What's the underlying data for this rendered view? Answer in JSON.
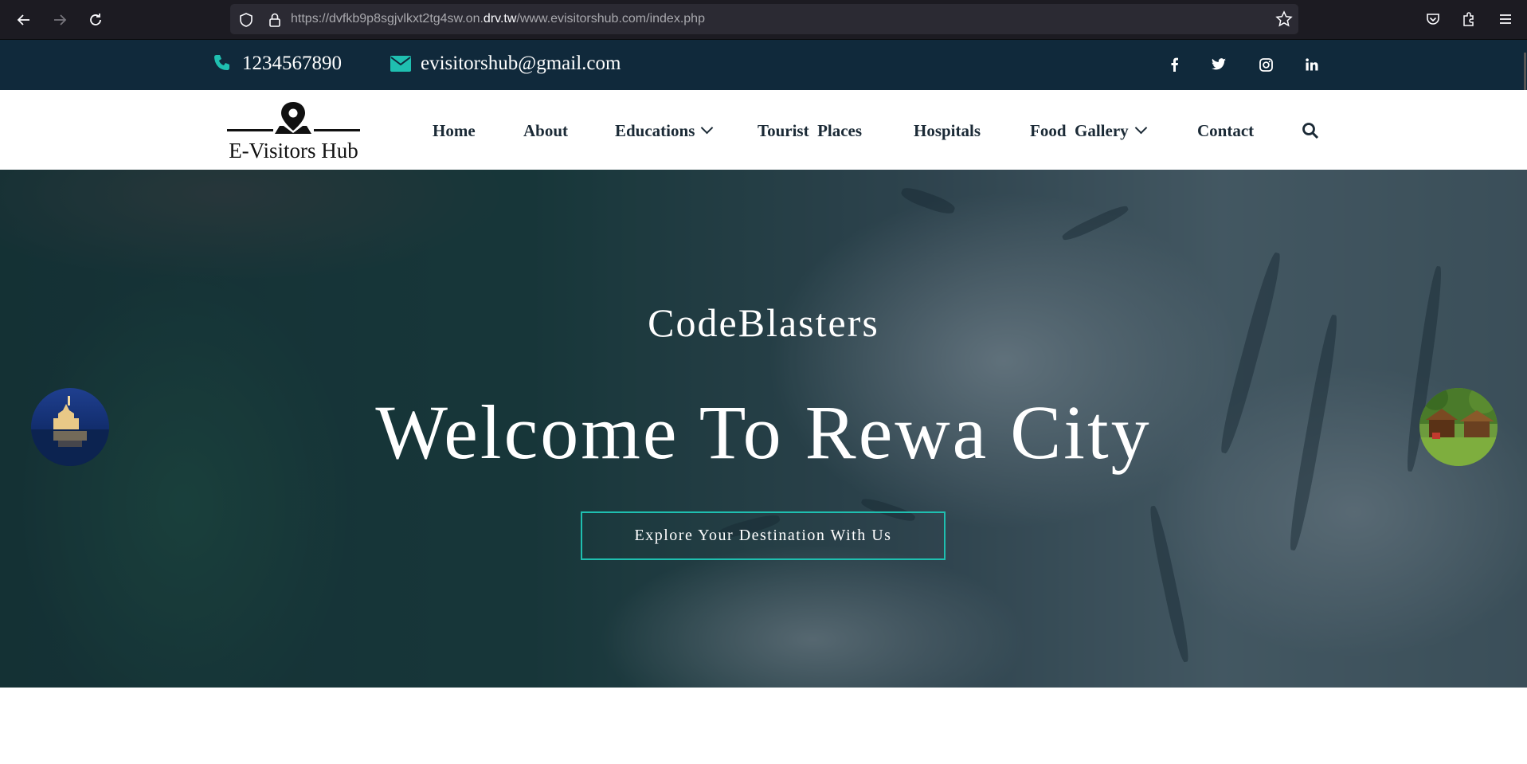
{
  "browser": {
    "url_prefix": "https://dvfkb9p8sgjvlkxt2tg4sw.on.",
    "url_domain": "drv.tw",
    "url_suffix": "/www.evisitorshub.com/index.php"
  },
  "topbar": {
    "phone": "1234567890",
    "email": "evisitorshub@gmail.com",
    "socials": [
      "facebook",
      "twitter",
      "instagram",
      "linkedin"
    ]
  },
  "header": {
    "logo_text": "E-Visitors Hub",
    "nav": {
      "home": "Home",
      "about": "About",
      "educations": "Educations",
      "tourist_places": "Tourist  Places",
      "hospitals": "Hospitals",
      "food_gallery": "Food  Gallery",
      "contact": "Contact"
    }
  },
  "hero": {
    "subtitle": "CodeBlasters",
    "title": "Welcome To Rewa City",
    "button": "Explore Your Destination With Us"
  },
  "colors": {
    "topbar_bg": "#10293b",
    "accent": "#1fbfb0",
    "nav_text": "#1b2a36"
  }
}
